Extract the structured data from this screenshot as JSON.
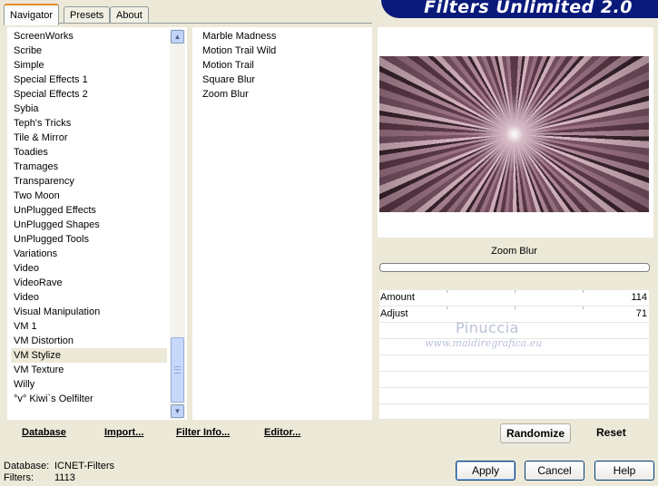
{
  "banner": {
    "title": "Filters Unlimited 2.0"
  },
  "tabs": [
    {
      "label": "Navigator",
      "active": true
    },
    {
      "label": "Presets",
      "active": false
    },
    {
      "label": "About",
      "active": false
    }
  ],
  "categories": {
    "items": [
      "ScreenWorks",
      "Scribe",
      "Simple",
      "Special Effects 1",
      "Special Effects 2",
      "Sybia",
      "Teph's Tricks",
      "Tile & Mirror",
      "Toadies",
      "Tramages",
      "Transparency",
      "Two Moon",
      "UnPlugged Effects",
      "UnPlugged Shapes",
      "UnPlugged Tools",
      "Variations",
      "Video",
      "VideoRave",
      "Video",
      "Visual Manipulation",
      "VM 1",
      "VM Distortion",
      "VM Stylize",
      "VM Texture",
      "Willy",
      "°v° Kiwi`s Oelfilter"
    ],
    "selected": "VM Stylize"
  },
  "filters": {
    "items": [
      "Marble Madness",
      "Motion Trail Wild",
      "Motion Trail",
      "Square Blur",
      "Zoom Blur"
    ],
    "selected": "Zoom Blur"
  },
  "preview": {
    "filter_name": "Zoom Blur"
  },
  "parameters": [
    {
      "label": "Amount",
      "value": "114"
    },
    {
      "label": "Adjust",
      "value": "71"
    }
  ],
  "watermark": {
    "name": "Pinuccia",
    "url": "www.maidiregrafica.eu"
  },
  "bottom_left": {
    "database": "Database",
    "import": "Import...",
    "filter_info": "Filter Info...",
    "editor": "Editor..."
  },
  "bottom_right": {
    "randomize": "Randomize",
    "reset": "Reset"
  },
  "status": {
    "database_label": "Database:",
    "database_value": "ICNET-Filters",
    "filters_label": "Filters:",
    "filters_value": "1113"
  },
  "dialog_buttons": {
    "apply": "Apply",
    "cancel": "Cancel",
    "help": "Help"
  },
  "colors": {
    "selection_blue": "#316ac5",
    "banner_navy": "#0a1a7a",
    "tab_accent": "#e68b2c"
  }
}
